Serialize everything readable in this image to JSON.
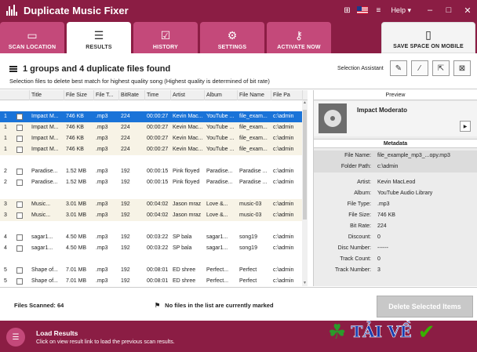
{
  "app": {
    "title": "Duplicate Music Fixer"
  },
  "titlebar": {
    "help_label": "Help",
    "help_arrow": "▾",
    "min": "–",
    "max": "□",
    "close": "✕",
    "grid_icon": "⊞",
    "menu_icon": "≡"
  },
  "tabs": [
    {
      "label": "SCAN LOCATION",
      "icon": "▭"
    },
    {
      "label": "RESULTS",
      "icon": "☰"
    },
    {
      "label": "HISTORY",
      "icon": "☑"
    },
    {
      "label": "SETTINGS",
      "icon": "⚙"
    },
    {
      "label": "ACTIVATE NOW",
      "icon": "⚷"
    },
    {
      "label": "SAVE SPACE ON MOBILE",
      "icon": "▯"
    }
  ],
  "header": {
    "found": "1 groups and 4 duplicate files found",
    "subtitle": "Selection files to delete best match for highest quality song (Highest quality is determined of bit rate)",
    "selection_assistant": "Selection Assistant"
  },
  "table": {
    "columns": [
      "",
      "Title",
      "File Size",
      "File T...",
      "BitRate",
      "Time",
      "Artist",
      "Album",
      "File Name",
      "File Pa"
    ],
    "rows": [
      {
        "group": "1",
        "title": "Impact M...",
        "size": "746 KB",
        "type": ".mp3",
        "bitrate": "224",
        "time": "00:00:27",
        "artist": "Kevin Mac...",
        "album": "YouTube ...",
        "file": "file_exam...",
        "path": "c:\\admin",
        "selected": true,
        "shade": false
      },
      {
        "group": "1",
        "title": "Impact M...",
        "size": "746 KB",
        "type": ".mp3",
        "bitrate": "224",
        "time": "00:00:27",
        "artist": "Kevin Mac...",
        "album": "YouTube ...",
        "file": "file_exam...",
        "path": "c:\\admin",
        "selected": false,
        "shade": true
      },
      {
        "group": "1",
        "title": "Impact M...",
        "size": "746 KB",
        "type": ".mp3",
        "bitrate": "224",
        "time": "00:00:27",
        "artist": "Kevin Mac...",
        "album": "YouTube ...",
        "file": "file_exam...",
        "path": "c:\\admin",
        "selected": false,
        "shade": true
      },
      {
        "group": "1",
        "title": "Impact M...",
        "size": "746 KB",
        "type": ".mp3",
        "bitrate": "224",
        "time": "00:00:27",
        "artist": "Kevin Mac...",
        "album": "YouTube ...",
        "file": "file_exam...",
        "path": "c:\\admin",
        "selected": false,
        "shade": true
      },
      {
        "group": "2",
        "title": "Paradise...",
        "size": "1.52 MB",
        "type": ".mp3",
        "bitrate": "192",
        "time": "00:00:15",
        "artist": "Pink floyed",
        "album": "Paradise...",
        "file": "Paradise ...",
        "path": "c:\\admin",
        "selected": false,
        "shade": false
      },
      {
        "group": "2",
        "title": "Paradise...",
        "size": "1.52 MB",
        "type": ".mp3",
        "bitrate": "192",
        "time": "00:00:15",
        "artist": "Pink floyed",
        "album": "Paradise...",
        "file": "Paradise ...",
        "path": "c:\\admin",
        "selected": false,
        "shade": false
      },
      {
        "group": "3",
        "title": "Music...",
        "size": "3.01 MB",
        "type": ".mp3",
        "bitrate": "192",
        "time": "00:04:02",
        "artist": "Jason mraz",
        "album": "Love &...",
        "file": "music-03",
        "path": "c:\\admin",
        "selected": false,
        "shade": true
      },
      {
        "group": "3",
        "title": "Music...",
        "size": "3.01 MB",
        "type": ".mp3",
        "bitrate": "192",
        "time": "00:04:02",
        "artist": "Jason mraz",
        "album": "Love &...",
        "file": "music-03",
        "path": "c:\\admin",
        "selected": false,
        "shade": true
      },
      {
        "group": "4",
        "title": "sagar1...",
        "size": "4.50 MB",
        "type": ".mp3",
        "bitrate": "192",
        "time": "00:03:22",
        "artist": "SP bala",
        "album": "sagar1...",
        "file": "song19",
        "path": "c:\\admin",
        "selected": false,
        "shade": false
      },
      {
        "group": "4",
        "title": "sagar1...",
        "size": "4.50 MB",
        "type": ".mp3",
        "bitrate": "192",
        "time": "00:03:22",
        "artist": "SP bala",
        "album": "sagar1...",
        "file": "song19",
        "path": "c:\\admin",
        "selected": false,
        "shade": false
      },
      {
        "group": "5",
        "title": "Shape of...",
        "size": "7.01 MB",
        "type": ".mp3",
        "bitrate": "192",
        "time": "00:08:01",
        "artist": "ED shree",
        "album": "Perfect...",
        "file": "Perfect",
        "path": "c:\\admin",
        "selected": false,
        "shade": false
      },
      {
        "group": "5",
        "title": "Shape of...",
        "size": "7.01 MB",
        "type": ".mp3",
        "bitrate": "192",
        "time": "00:08:01",
        "artist": "ED shree",
        "album": "Perfect...",
        "file": "Perfect",
        "path": "c:\\admin",
        "selected": false,
        "shade": false
      }
    ]
  },
  "preview": {
    "title": "Preview",
    "song": "Impact Moderato",
    "metadata_title": "Metadata",
    "fields": [
      {
        "k": "File Name:",
        "v": "file_example_mp3_...opy.mp3"
      },
      {
        "k": "Folder Path:",
        "v": "c:\\admin"
      },
      {
        "k": "Artist:",
        "v": "Kevin MacLeod"
      },
      {
        "k": "Album:",
        "v": "YouTube Audio Library"
      },
      {
        "k": "File Type:",
        "v": ".mp3"
      },
      {
        "k": "File Size:",
        "v": "746 KB"
      },
      {
        "k": "Bit Rate:",
        "v": "224"
      },
      {
        "k": "Discount:",
        "v": "0"
      },
      {
        "k": "Disc Number:",
        "v": "------"
      },
      {
        "k": "Track Count:",
        "v": "0"
      },
      {
        "k": "Track Number:",
        "v": "3"
      }
    ]
  },
  "footer": {
    "scanned": "Files Scanned: 64",
    "marked": "No files in the list are currently marked",
    "delete_button": "Delete Selected Items"
  },
  "bottom": {
    "load_title": "Load Results",
    "load_sub": "Click on view result link to load the previous scan results."
  },
  "watermark": {
    "text": "TẢI VỀ"
  }
}
